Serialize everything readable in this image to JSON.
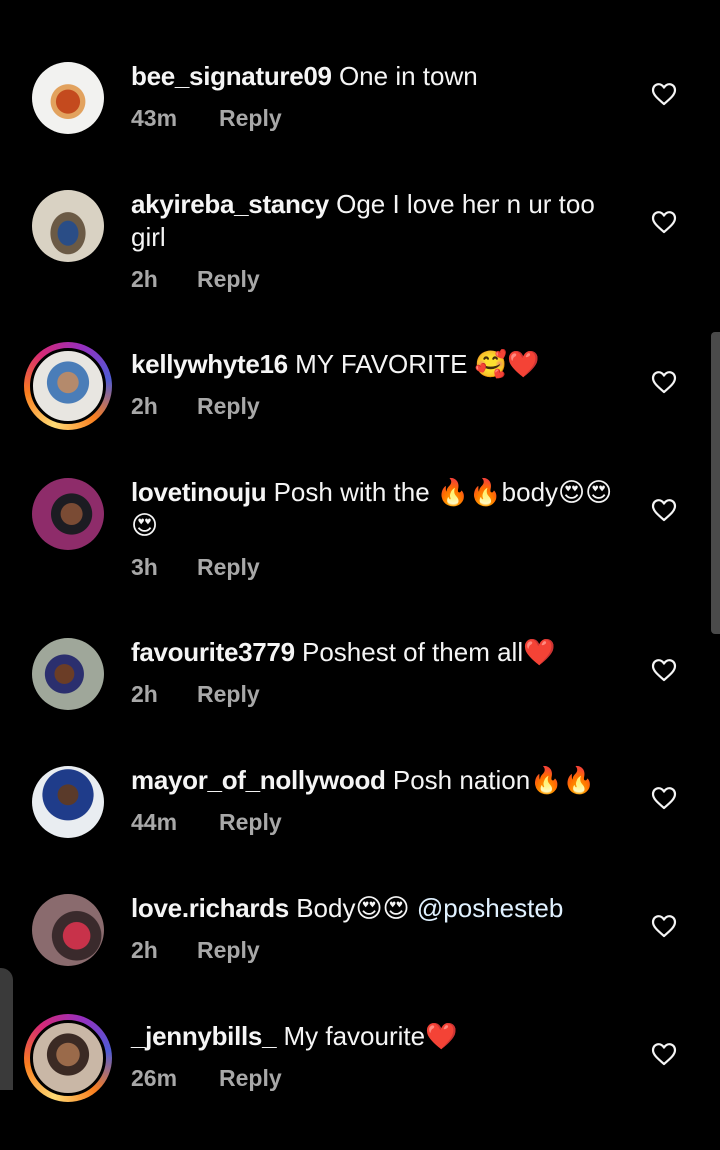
{
  "comments": [
    {
      "username": "bee_signature09",
      "text": "One in town",
      "time": "43m",
      "reply": "Reply",
      "icon": "heart-outline-icon"
    },
    {
      "username": "akyireba_stancy",
      "text": "Oge I love her n ur too girl",
      "time": "2h",
      "reply": "Reply",
      "icon": "heart-outline-icon"
    },
    {
      "username": "kellywhyte16",
      "text": "MY FAVORITE 🥰❤️",
      "time": "2h",
      "reply": "Reply",
      "icon": "heart-outline-icon"
    },
    {
      "username": "lovetinouju",
      "text": "Posh with the 🔥🔥body😍😍😍",
      "time": "3h",
      "reply": "Reply",
      "icon": "heart-outline-icon"
    },
    {
      "username": "favourite3779",
      "text": "Poshest of them all❤️",
      "time": "2h",
      "reply": "Reply",
      "icon": "heart-outline-icon"
    },
    {
      "username": "mayor_of_nollywood",
      "text": "Posh nation🔥🔥",
      "time": "44m",
      "reply": "Reply",
      "icon": "heart-outline-icon"
    },
    {
      "username": "love.richards",
      "text": "Body😍😍",
      "mention": "@poshesteb",
      "time": "2h",
      "reply": "Reply",
      "icon": "heart-outline-icon"
    },
    {
      "username": "_jennybills_",
      "text": "My favourite❤️",
      "time": "26m",
      "reply": "Reply",
      "icon": "heart-outline-icon"
    }
  ],
  "colors": {
    "background": "#000000",
    "text": "#f5f5f5",
    "meta": "#a8a8a8",
    "mention": "#e0f1ff"
  }
}
